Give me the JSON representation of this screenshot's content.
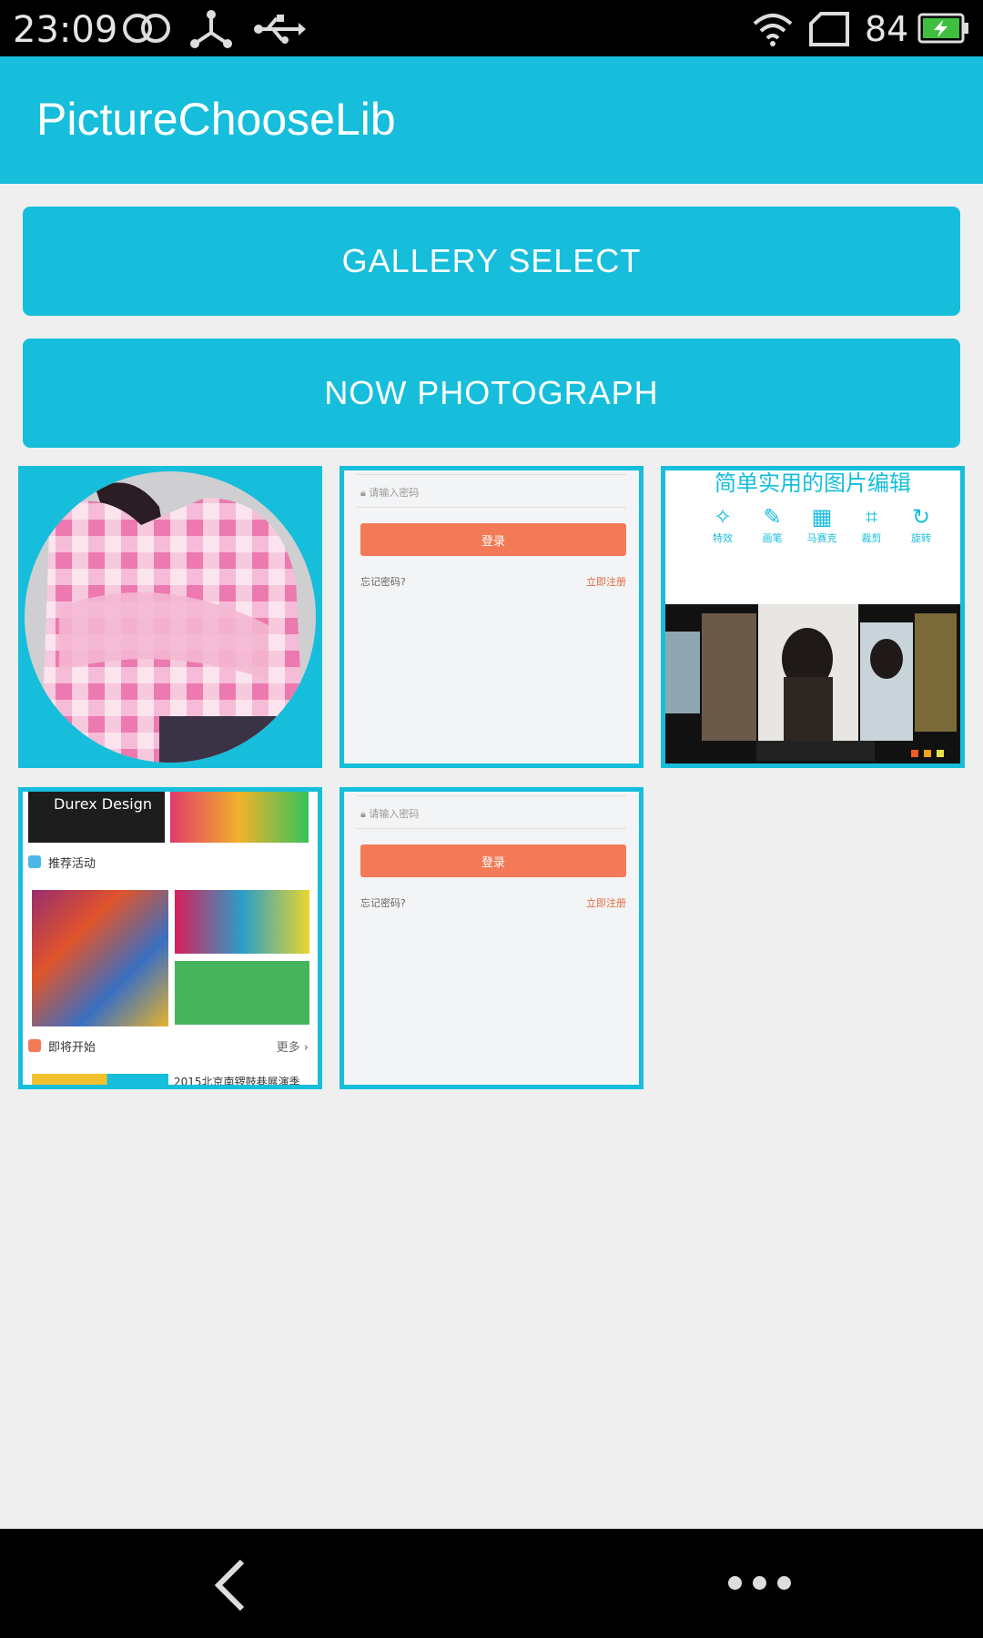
{
  "status_bar": {
    "time": "23:09",
    "battery_level": "84",
    "icons": [
      "dual-circle-icon",
      "usb-network-icon",
      "usb-icon",
      "wifi-icon",
      "sim-icon",
      "battery-charging-icon"
    ]
  },
  "app_bar": {
    "title": "PictureChooseLib"
  },
  "buttons": {
    "gallery_label": "GALLERY SELECT",
    "photo_label": "NOW PHOTOGRAPH"
  },
  "grid": {
    "login_thumb": {
      "password_placeholder": "请输入密码",
      "login_label": "登录",
      "forgot_label": "忘记密码?",
      "register_label": "立即注册"
    },
    "editor_thumb": {
      "heading": "简单实用的图片编辑",
      "tools": [
        {
          "icon": "magic-wand-icon",
          "label": "特效"
        },
        {
          "icon": "brush-icon",
          "label": "画笔"
        },
        {
          "icon": "mosaic-icon",
          "label": "马赛克"
        },
        {
          "icon": "crop-icon",
          "label": "裁剪"
        },
        {
          "icon": "rotate-icon",
          "label": "旋转"
        }
      ]
    },
    "app_thumb": {
      "banner_left": "Durex Design",
      "section1": "推荐活动",
      "section2": "即将开始",
      "more": "更多 ›",
      "event_text": "2015北京南锣鼓巷展演季"
    }
  },
  "colors": {
    "accent": "#16bedb",
    "login_button": "#f37a56",
    "background": "#efefef"
  }
}
